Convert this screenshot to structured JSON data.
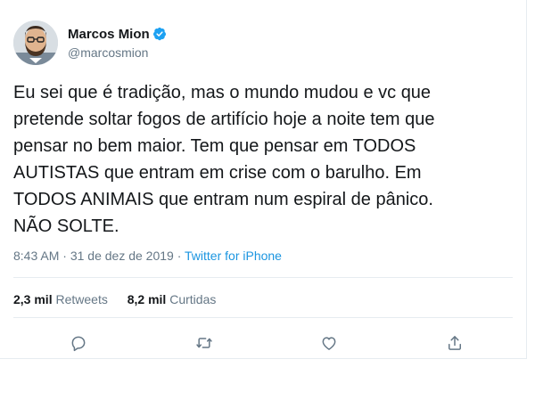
{
  "user": {
    "display_name": "Marcos Mion",
    "handle": "@marcosmion",
    "verified": true
  },
  "tweet": {
    "text": "Eu sei que é tradição, mas o mundo mudou e vc que\npretende soltar fogos de artifício hoje a noite tem que\npensar no bem maior. Tem que pensar em TODOS\nAUTISTAS que entram em crise com o barulho. Em\nTODOS ANIMAIS que entram num espiral de pânico.\nNÃO SOLTE.",
    "time": "8:43 AM",
    "separator": "·",
    "date": "31 de dez de 2019",
    "source": "Twitter for iPhone"
  },
  "stats": {
    "retweets_count": "2,3 mil",
    "retweets_label": "Retweets",
    "likes_count": "8,2 mil",
    "likes_label": "Curtidas"
  },
  "actions": [
    "reply-icon",
    "retweet-icon",
    "like-icon",
    "share-icon"
  ],
  "colors": {
    "link": "#1b95e0",
    "verified": "#1da1f2",
    "muted": "#657786",
    "text": "#14171a"
  }
}
